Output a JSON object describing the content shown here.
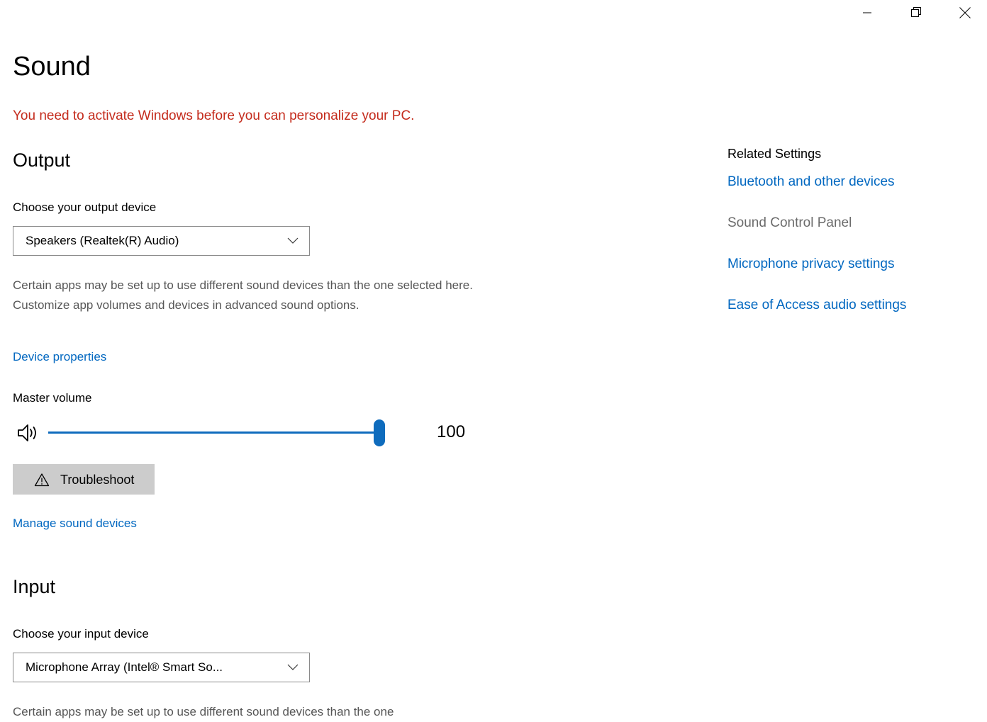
{
  "window": {
    "controls": [
      {
        "name": "minimize",
        "label": "Minimize"
      },
      {
        "name": "restore",
        "label": "Restore"
      },
      {
        "name": "close",
        "label": "Close"
      }
    ]
  },
  "header": {
    "title": "Sound",
    "activation_warning": "You need to activate Windows before you can personalize your PC."
  },
  "output": {
    "heading": "Output",
    "device_label": "Choose your output device",
    "device_value": "Speakers (Realtek(R) Audio)",
    "description": "Certain apps may be set up to use different sound devices than the one selected here. Customize app volumes and devices in advanced sound options.",
    "device_properties_link": "Device properties",
    "master_volume_label": "Master volume",
    "master_volume_value": "100",
    "troubleshoot_label": "Troubleshoot",
    "manage_devices_link": "Manage sound devices"
  },
  "input": {
    "heading": "Input",
    "device_label": "Choose your input device",
    "device_value": "Microphone Array (Intel® Smart So...",
    "description": "Certain apps may be set up to use different sound devices than the one"
  },
  "related_settings": {
    "heading": "Related Settings",
    "items": [
      {
        "label": "Bluetooth and other devices",
        "state": "link"
      },
      {
        "label": "Sound Control Panel",
        "state": "disabled"
      },
      {
        "label": "Microphone privacy settings",
        "state": "link"
      },
      {
        "label": "Ease of Access audio settings",
        "state": "link"
      }
    ]
  },
  "colors": {
    "accent": "#0f6cbd",
    "link": "#0067c0",
    "warning_red": "#c42b1c",
    "muted_text": "#565656",
    "disabled_text": "#6b6b6b",
    "button_face": "#cccccc",
    "combo_border": "#8a8a8a"
  }
}
